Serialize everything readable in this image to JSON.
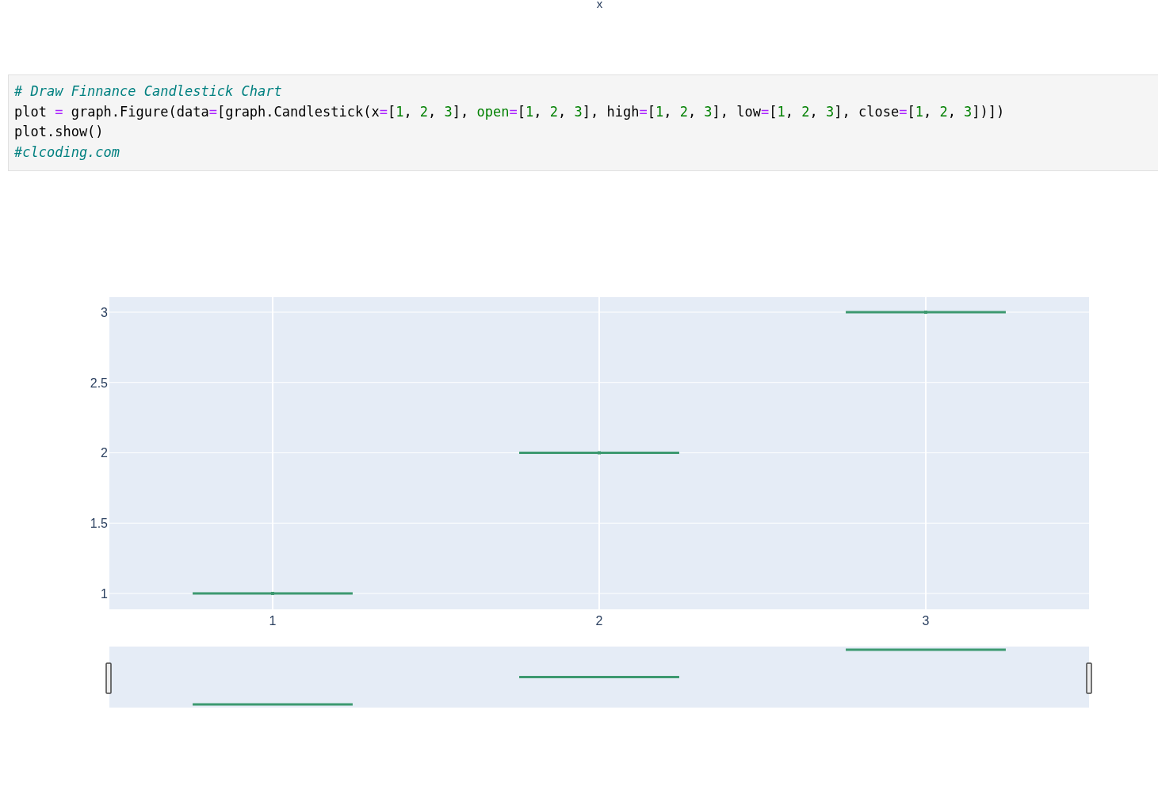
{
  "axis_title_top": "x",
  "code_cell": {
    "lines": [
      [
        {
          "kind": "comment",
          "text": "# Draw Finnance Candlestick Chart"
        }
      ],
      [
        {
          "kind": "plain",
          "text": "plot "
        },
        {
          "kind": "op",
          "text": "="
        },
        {
          "kind": "plain",
          "text": " graph.Figure(data"
        },
        {
          "kind": "op",
          "text": "="
        },
        {
          "kind": "plain",
          "text": "[graph.Candlestick(x"
        },
        {
          "kind": "op",
          "text": "="
        },
        {
          "kind": "plain",
          "text": "["
        },
        {
          "kind": "num",
          "text": "1"
        },
        {
          "kind": "plain",
          "text": ", "
        },
        {
          "kind": "num",
          "text": "2"
        },
        {
          "kind": "plain",
          "text": ", "
        },
        {
          "kind": "num",
          "text": "3"
        },
        {
          "kind": "plain",
          "text": "], "
        },
        {
          "kind": "builtin",
          "text": "open"
        },
        {
          "kind": "op",
          "text": "="
        },
        {
          "kind": "plain",
          "text": "["
        },
        {
          "kind": "num",
          "text": "1"
        },
        {
          "kind": "plain",
          "text": ", "
        },
        {
          "kind": "num",
          "text": "2"
        },
        {
          "kind": "plain",
          "text": ", "
        },
        {
          "kind": "num",
          "text": "3"
        },
        {
          "kind": "plain",
          "text": "], high"
        },
        {
          "kind": "op",
          "text": "="
        },
        {
          "kind": "plain",
          "text": "["
        },
        {
          "kind": "num",
          "text": "1"
        },
        {
          "kind": "plain",
          "text": ", "
        },
        {
          "kind": "num",
          "text": "2"
        },
        {
          "kind": "plain",
          "text": ", "
        },
        {
          "kind": "num",
          "text": "3"
        },
        {
          "kind": "plain",
          "text": "], low"
        },
        {
          "kind": "op",
          "text": "="
        },
        {
          "kind": "plain",
          "text": "["
        },
        {
          "kind": "num",
          "text": "1"
        },
        {
          "kind": "plain",
          "text": ", "
        },
        {
          "kind": "num",
          "text": "2"
        },
        {
          "kind": "plain",
          "text": ", "
        },
        {
          "kind": "num",
          "text": "3"
        },
        {
          "kind": "plain",
          "text": "], close"
        },
        {
          "kind": "op",
          "text": "="
        },
        {
          "kind": "plain",
          "text": "["
        },
        {
          "kind": "num",
          "text": "1"
        },
        {
          "kind": "plain",
          "text": ", "
        },
        {
          "kind": "num",
          "text": "2"
        },
        {
          "kind": "plain",
          "text": ", "
        },
        {
          "kind": "num",
          "text": "3"
        },
        {
          "kind": "plain",
          "text": "])])"
        }
      ],
      [
        {
          "kind": "plain",
          "text": "plot.show()"
        }
      ],
      [
        {
          "kind": "comment",
          "text": "#clcoding.com"
        }
      ]
    ]
  },
  "chart": {
    "chart_data": {
      "type": "scatter",
      "x": [
        1,
        2,
        3
      ],
      "series": [
        {
          "color": "#3d9970",
          "values": [
            1,
            2,
            3
          ]
        }
      ],
      "grid": true,
      "xlim": [
        0.5,
        3.5
      ],
      "ylim": [
        0.887,
        3.107
      ],
      "xticks": [
        1,
        2,
        3
      ],
      "yticks": [
        1,
        1.5,
        2,
        2.5,
        3
      ]
    }
  }
}
